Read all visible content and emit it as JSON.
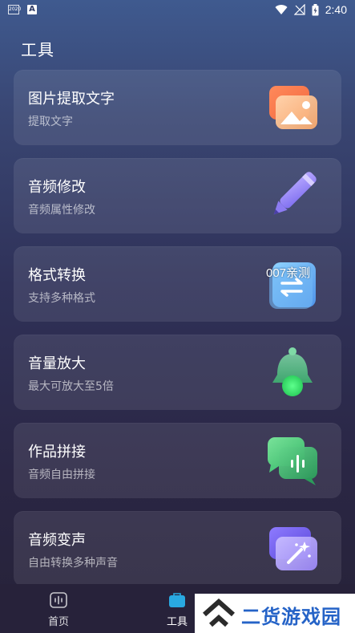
{
  "status_bar": {
    "time": "2:40",
    "left_icons": [
      "notification-icon",
      "a-icon"
    ],
    "right_icons": [
      "wifi-icon",
      "no-signal-icon",
      "battery-icon"
    ],
    "mini_label": "2020"
  },
  "page": {
    "title": "工具"
  },
  "tools": [
    {
      "title": "图片提取文字",
      "subtitle": "提取文字",
      "icon": "image-icon"
    },
    {
      "title": "音频修改",
      "subtitle": "音频属性修改",
      "icon": "pencil-icon"
    },
    {
      "title": "格式转换",
      "subtitle": "支持多种格式",
      "icon": "swap-icon",
      "overlay": "007亲测"
    },
    {
      "title": "音量放大",
      "subtitle": "最大可放大至5倍",
      "icon": "bell-icon"
    },
    {
      "title": "作品拼接",
      "subtitle": "音频自由拼接",
      "icon": "chat-bubbles-icon"
    },
    {
      "title": "音频变声",
      "subtitle": "自由转换多种声音",
      "icon": "magic-wand-icon"
    }
  ],
  "bottom_nav": [
    {
      "label": "首页",
      "icon": "waveform-icon",
      "active": false
    },
    {
      "label": "工具",
      "icon": "toolbox-icon",
      "active": true
    }
  ],
  "watermark": {
    "text": "二货游戏园"
  },
  "colors": {
    "accent": "#29a9e1",
    "background": "#2f3158",
    "watermark_blue": "#2563c7"
  }
}
